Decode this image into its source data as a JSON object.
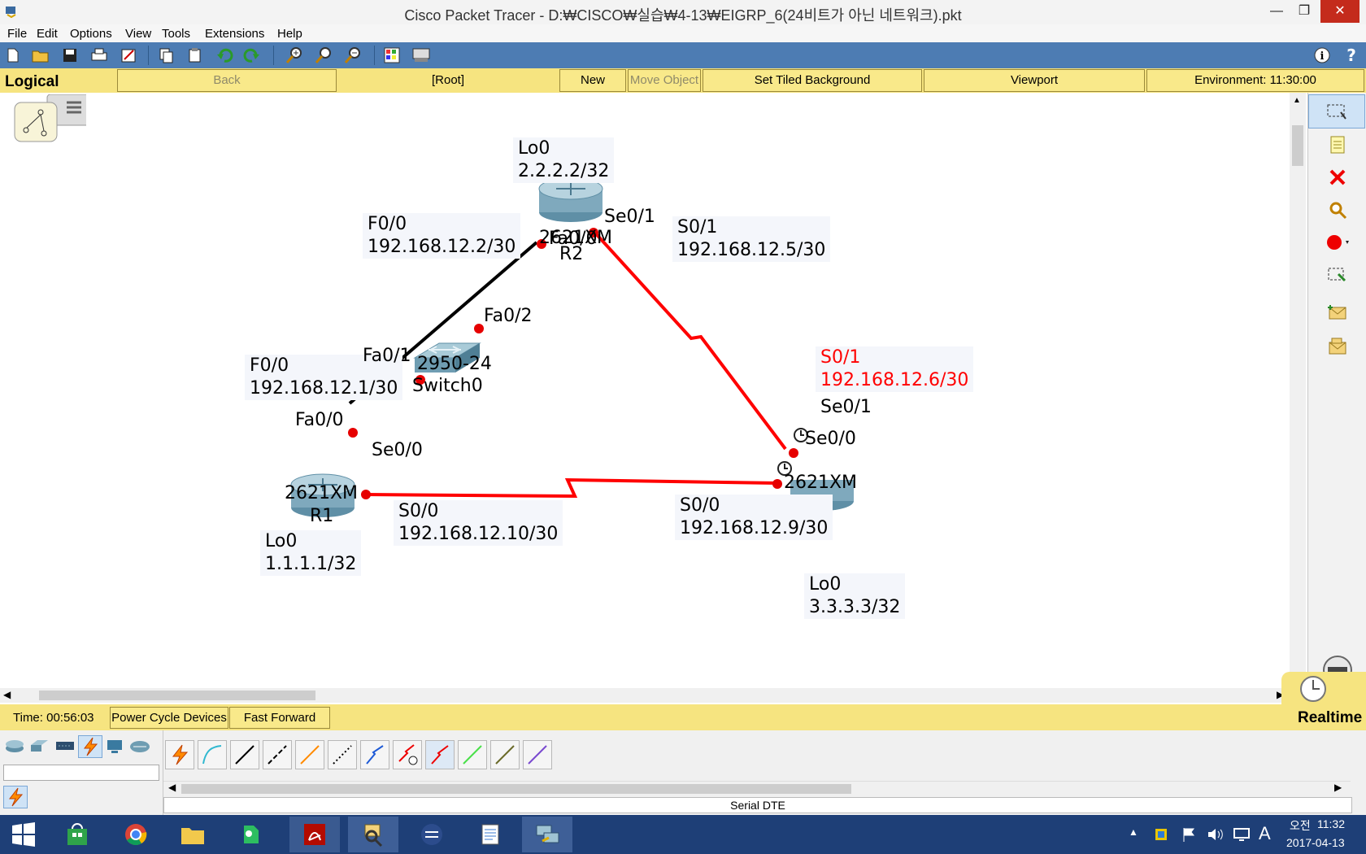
{
  "window": {
    "title": "Cisco Packet Tracer - D:₩CISCO₩실습₩4-13₩EIGRP_6(24비트가 아닌 네트워크).pkt",
    "minimize": "—",
    "maximize": "❐",
    "close": "✕"
  },
  "menu": [
    "File",
    "Edit",
    "Options",
    "View",
    "Tools",
    "Extensions",
    "Help"
  ],
  "toolbar": {
    "icons": [
      "new-file",
      "open-folder",
      "save",
      "print",
      "activity-wizard",
      "copy",
      "paste",
      "undo",
      "redo",
      "zoom-in",
      "zoom-reset",
      "zoom-out",
      "palette",
      "custom-device"
    ],
    "info": "i",
    "help": "?"
  },
  "logical_bar": {
    "mode": "Logical",
    "back": "Back",
    "root": "[Root]",
    "new_cluster": "New Cluster",
    "move_object": "Move Object",
    "set_tiled_background": "Set Tiled Background",
    "viewport": "Viewport",
    "environment": "Environment: 11:30:00"
  },
  "topology": {
    "notes": {
      "r2_lo0": "Lo0\n2.2.2.2/32",
      "r2_f00": "F0/0\n192.168.12.2/30",
      "r2_s01": "S0/1\n192.168.12.5/30",
      "r3_s01": "S0/1\n192.168.12.6/30",
      "r1_f00": "F0/0\n192.168.12.1/30",
      "r1_s00": "S0/0\n192.168.12.10/30",
      "r3_s00": "S0/0\n192.168.12.9/30",
      "r1_lo0": "Lo0\n1.1.1.1/32",
      "r3_lo0": "Lo0\n3.3.3.3/32"
    },
    "port_labels": {
      "r2_se01": "Se0/1",
      "r2_fa00": "Fa0/0",
      "sw_fa02": "Fa0/2",
      "sw_fa01": "Fa0/1",
      "r1_fa00": "Fa0/0",
      "r1_se00": "Se0/0",
      "r3_se01": "Se0/1",
      "r3_se00": "Se0/0"
    },
    "devices": {
      "r2_model": "2621XM",
      "r2_name": "R2",
      "switch_model": "2950-24",
      "switch_name": "Switch0",
      "r1_model": "2621XM",
      "r1_name": "R1",
      "r3_model": "2621XM"
    },
    "colors": {
      "serial_link": "#ff0000",
      "ethernet_link": "#000000",
      "highlight_note": "#ff0000"
    }
  },
  "status_bar": {
    "time": "Time: 00:56:03",
    "power_cycle": "Power Cycle Devices",
    "fast_forward": "Fast Forward Time",
    "mode": "Realtime"
  },
  "device_panel": {
    "categories": [
      "routers",
      "switches",
      "hubs",
      "wireless",
      "connections",
      "end-devices",
      "wan-emulation"
    ],
    "connections": [
      "automatic",
      "console",
      "copper-straight",
      "copper-cross",
      "fiber",
      "phone",
      "coaxial",
      "serial-dce",
      "serial-dte",
      "octal",
      "iot",
      "usb"
    ],
    "selected_connection_name": "Serial DTE"
  },
  "taskbar": {
    "apps": [
      "store",
      "chrome",
      "file-explorer",
      "evernote",
      "acrobat",
      "packet-tracer-search",
      "packet-tracer",
      "notepad",
      "network"
    ],
    "ampm": "오전",
    "clock": "11:32",
    "date": "2017-04-13",
    "ime": "A"
  }
}
